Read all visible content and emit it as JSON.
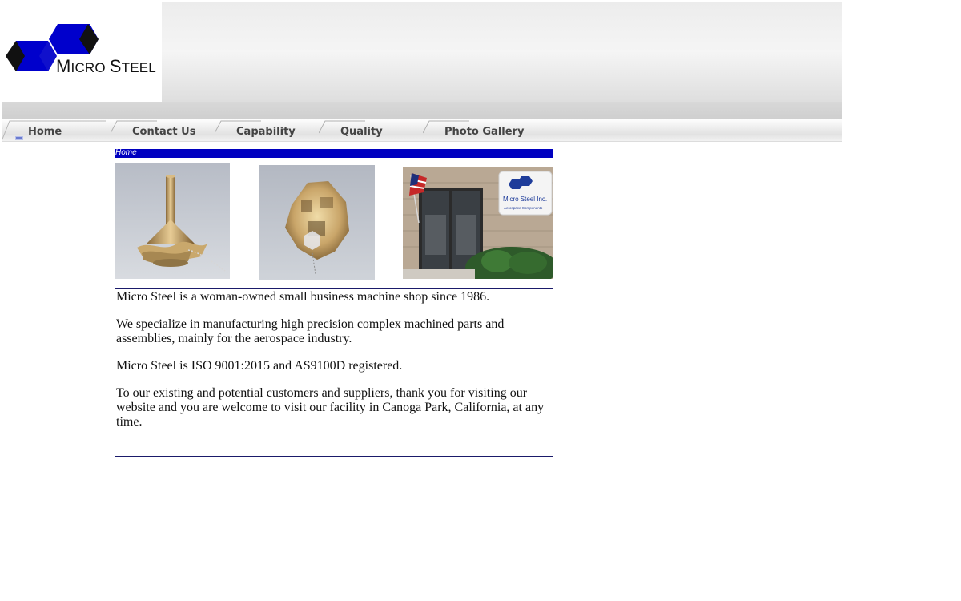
{
  "brand": {
    "name_initial_1": "M",
    "name_rest_1": "ICRO ",
    "name_initial_2": "S",
    "name_rest_2": "TEEL",
    "logo_color": "#0000cc"
  },
  "nav": {
    "items": [
      {
        "label": "Home",
        "active": true
      },
      {
        "label": "Contact Us"
      },
      {
        "label": "Capability"
      },
      {
        "label": "Quality"
      },
      {
        "label": "Photo Gallery"
      }
    ]
  },
  "breadcrumb": {
    "label": "Home",
    "color": "#0000c0"
  },
  "photos": {
    "sign_line_1": "Micro Steel Inc.",
    "sign_line_2": "Aerospace Components"
  },
  "content": {
    "paragraphs": [
      "Micro Steel is a woman-owned small business machine shop since 1986.",
      "We specialize in manufacturing high precision complex machined parts and assemblies, mainly for the aerospace industry.",
      "Micro Steel is ISO 9001:2015 and AS9100D registered.",
      "To our existing and  potential customers and suppliers, thank you for visiting our website and you are welcome to visit our facility in Canoga Park, California, at any time."
    ]
  }
}
